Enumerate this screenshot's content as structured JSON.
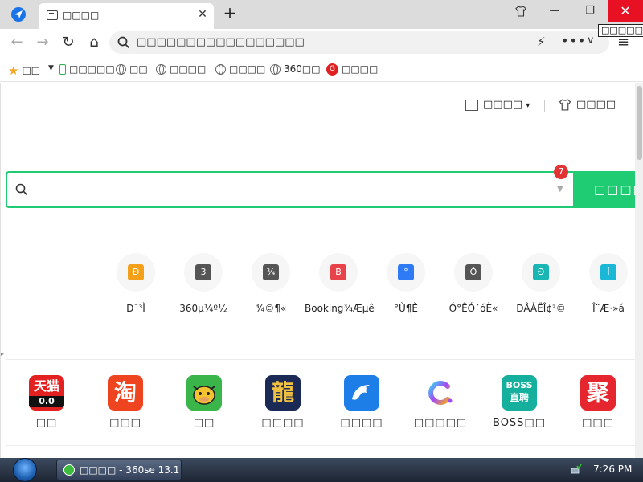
{
  "window": {
    "tab_title": "□□□□",
    "tab_close": "✕",
    "new_tab": "+",
    "skin_icon": "shirt-icon",
    "minimize": "—",
    "maximize": "❐",
    "close": "✕",
    "tooltip": "□□□□□",
    "close_color": "#e81123"
  },
  "navbar": {
    "back": "←",
    "forward": "→",
    "reload": "↻",
    "home": "⌂",
    "address_placeholder": "□□□□□□□□□□□□□□□□□",
    "bolt": "⚡",
    "more": "•••",
    "chevron": "∨",
    "menu": "≡"
  },
  "bookmarks": [
    {
      "icon": "star-icon",
      "label": "□□"
    },
    {
      "icon": "phone-icon",
      "label": "□□□□□"
    },
    {
      "icon": "globe-icon",
      "label": "□□"
    },
    {
      "icon": "globe-icon",
      "label": "□□□□"
    },
    {
      "icon": "globe-icon",
      "label": "□□□□"
    },
    {
      "icon": "globe-icon",
      "label": "360□□"
    },
    {
      "icon": "360-red-icon",
      "label": "□□□□"
    }
  ],
  "page": {
    "layout_link": "□□□□",
    "layout_caret": "▾",
    "skin_link": "□□□□",
    "search_badge": "7",
    "search_button": "□□□□",
    "accent_color": "#1fcb73"
  },
  "sites": [
    {
      "glyph": "Ð",
      "label": "Ð¯³Ì",
      "color": "#f5a01a"
    },
    {
      "glyph": "3",
      "label": "360µ¼º½",
      "color": "#555555"
    },
    {
      "glyph": "¾",
      "label": "¾©¶«",
      "color": "#555555"
    },
    {
      "glyph": "B",
      "label": "Booking¾Æµê",
      "color": "#e8434a"
    },
    {
      "glyph": "°",
      "label": "°Ù¶È",
      "color": "#2f7bf5"
    },
    {
      "glyph": "Ó",
      "label": "Ó°ÊÓ´óÈ«",
      "color": "#555555"
    },
    {
      "glyph": "Ð",
      "label": "ÐÂÀËÎ¢²©",
      "color": "#19b6b4"
    },
    {
      "glyph": "Î",
      "label": "Î¨Æ·»á",
      "color": "#1ab8d6"
    }
  ],
  "apps": [
    {
      "name": "tmall",
      "logo_text": "天猫",
      "logo_sub": "0.0",
      "label": "□□",
      "color": "#e32121"
    },
    {
      "name": "taobao",
      "logo_text": "淘",
      "label": "□□□",
      "color": "#ee4520"
    },
    {
      "name": "cow-game",
      "logo_text": "",
      "label": "□□",
      "color": "#39b54a"
    },
    {
      "name": "dragon-game",
      "logo_text": "龍",
      "label": "□□□□",
      "color": "#1b2a55"
    },
    {
      "name": "ctrip",
      "logo_text": "",
      "label": "□□□□",
      "color": "#1e7ee8"
    },
    {
      "name": "c-app",
      "logo_text": "C",
      "label": "□□□□□",
      "color": "#ffffff"
    },
    {
      "name": "boss",
      "logo_text": "BOSS",
      "logo_sub": "直聘",
      "label": "BOSS□□",
      "color": "#15b09d"
    },
    {
      "name": "juhuasuan",
      "logo_text": "聚",
      "label": "□□□",
      "color": "#e5262e"
    }
  ],
  "taskbar": {
    "task_title": "□□□□ - 360se 13.1",
    "clock": "7:26 PM"
  }
}
